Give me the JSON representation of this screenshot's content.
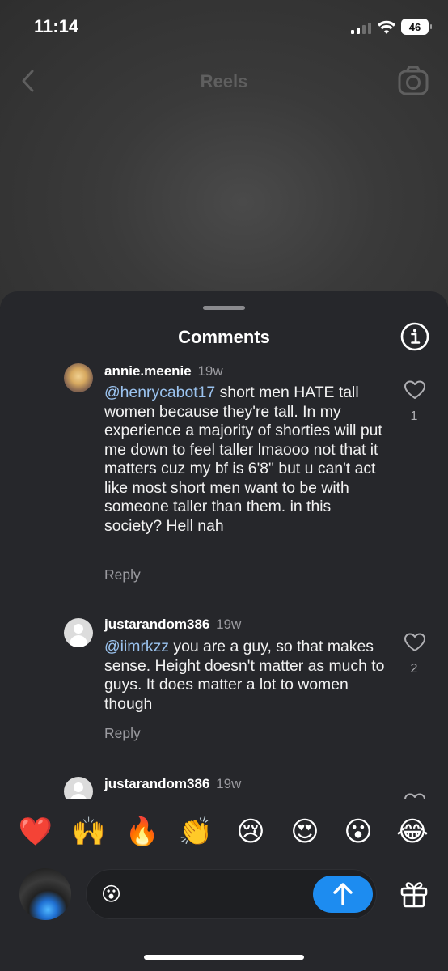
{
  "status": {
    "time": "11:14",
    "battery": "46"
  },
  "header": {
    "title": "Reels"
  },
  "sheet": {
    "title": "Comments"
  },
  "comments": [
    {
      "username": "annie.meenie",
      "time": "19w",
      "mention": "@henrycabot17",
      "text": " short men HATE tall women because they're tall. In my experience a majority of shorties will put me down to feel taller lmaooo not that it matters cuz my bf is 6'8\" but u can't act like most short men want to be with someone taller than them. in this society? Hell nah",
      "likes": "1",
      "reply_label": "Reply"
    },
    {
      "username": "justarandom386",
      "time": "19w",
      "mention": "@iimrkzz",
      "text": " you are a guy, so that makes sense. Height doesn't matter as much to guys. It does matter a lot to women though",
      "likes": "2",
      "reply_label": "Reply"
    },
    {
      "username": "justarandom386",
      "time": "19w"
    }
  ],
  "reactions": [
    "❤️",
    "🙌",
    "🔥",
    "👏",
    "😢",
    "😍",
    "😮",
    "😂"
  ],
  "composer": {
    "emoji": "😮"
  },
  "icons": {
    "back": "chevron-left-icon",
    "camera": "camera-icon",
    "info": "info-icon",
    "heart": "heart-icon",
    "send": "arrow-up-icon",
    "gift": "gift-icon"
  },
  "colors": {
    "accent": "#1d8cf0",
    "mention": "#9bc3ef",
    "sheet": "#26272b"
  }
}
